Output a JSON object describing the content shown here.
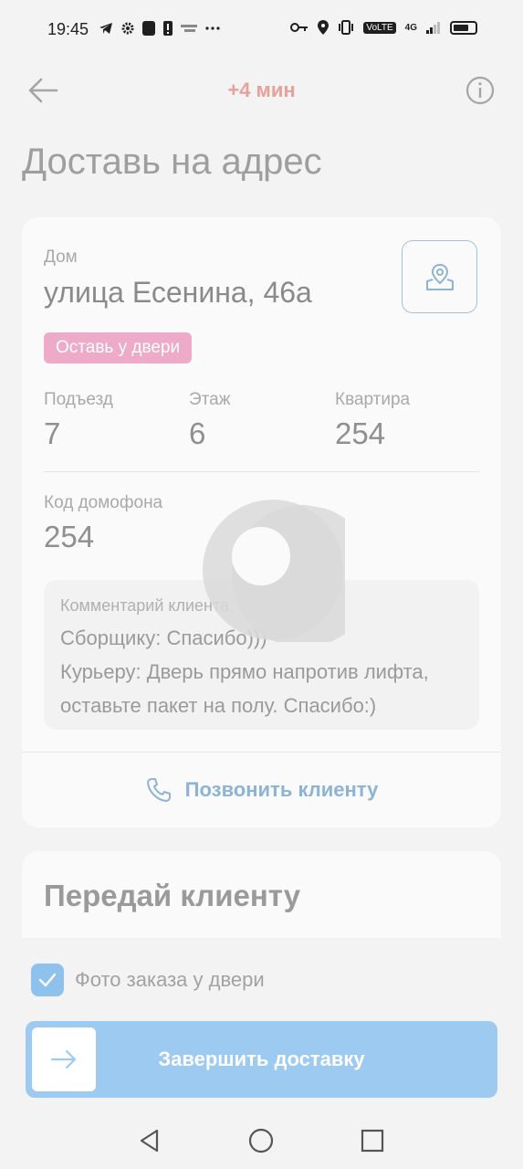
{
  "status_bar": {
    "time": "19:45",
    "network": "4G",
    "volte": "VoLTE"
  },
  "header": {
    "timer": "+4 мин"
  },
  "page": {
    "title": "Доставь на адрес"
  },
  "address_card": {
    "type_label": "Дом",
    "street": "улица Есенина, 46а",
    "badge": "Оставь у двери",
    "fields": [
      {
        "label": "Подъезд",
        "value": "7"
      },
      {
        "label": "Этаж",
        "value": "6"
      },
      {
        "label": "Квартира",
        "value": "254"
      }
    ],
    "intercom": {
      "label": "Код домофона",
      "value": "254"
    },
    "comment": {
      "label": "Комментарий клиента",
      "lines": [
        "Сборщику: Спасибо)))",
        "Курьеру: Дверь прямо напротив лифта, оставьте пакет на полу. Спасибо:)"
      ]
    },
    "call_label": "Позвонить клиенту"
  },
  "handover": {
    "title": "Передай клиенту",
    "photo_check_label": "Фото заказа у двери",
    "photo_checked": true
  },
  "complete_slider": {
    "label": "Завершить доставку"
  },
  "colors": {
    "accent": "#9ccaf0",
    "timer": "#e8a09c",
    "badge": "#eeabc8",
    "link": "#8db3d6"
  }
}
